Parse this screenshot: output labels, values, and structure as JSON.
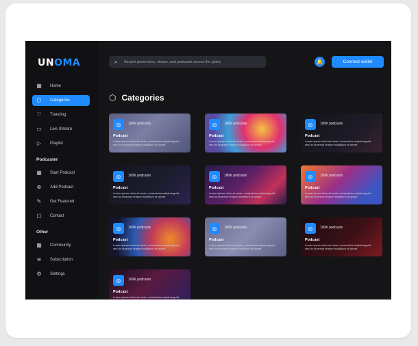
{
  "app": {
    "logo_prefix": "UN",
    "logo_accent": "OMA"
  },
  "sidebar": {
    "main": [
      {
        "label": "Home",
        "icon": "home-icon",
        "glyph": "▦",
        "active": false
      },
      {
        "label": "Categories",
        "icon": "categories-icon",
        "glyph": "⬡",
        "active": true
      },
      {
        "label": "Trending",
        "icon": "trending-icon",
        "glyph": "♡",
        "active": false
      },
      {
        "label": "Live Stream",
        "icon": "live-stream-icon",
        "glyph": "▭",
        "active": false
      },
      {
        "label": "Playlist",
        "icon": "playlist-icon",
        "glyph": "▷",
        "active": false
      }
    ],
    "podcaster_heading": "Podcaster",
    "podcaster": [
      {
        "label": "Start Podcast",
        "icon": "start-podcast-icon",
        "glyph": "▦"
      },
      {
        "label": "Add Podcast",
        "icon": "add-podcast-icon",
        "glyph": "⊕"
      },
      {
        "label": "Get Featured",
        "icon": "get-featured-icon",
        "glyph": "✎"
      },
      {
        "label": "Contact",
        "icon": "contact-icon",
        "glyph": "▢"
      }
    ],
    "other_heading": "Other",
    "other": [
      {
        "label": "Community",
        "icon": "community-icon",
        "glyph": "▦"
      },
      {
        "label": "Subscription",
        "icon": "subscription-icon",
        "glyph": "≋"
      },
      {
        "label": "Settings",
        "icon": "settings-icon",
        "glyph": "⚙"
      }
    ]
  },
  "header": {
    "search_placeholder": "Search presenters, shows, and podcasts across the globe",
    "connect_label": "Connect wallet"
  },
  "main": {
    "title": "Categories",
    "cards": [
      {
        "count": "100K podcasts",
        "title": "Podcast",
        "desc": "Lorem ipsum dolor sit amet, consectetur adipiscing elit, sed do eiusmod tempor incididunt ut labore",
        "bg": "linear-gradient(135deg,#5b5f86 0%,#7c7fa3 45%,#50557a 100%)"
      },
      {
        "count": "180K podcasts",
        "title": "Podcast",
        "desc": "Lorem ipsum dolor sit amet, consectetur adipiscing elit, sed do eiusmod tempor incididunt ut labore",
        "bg": "radial-gradient(circle at 70% 40%,#f5c33b 0%,#e0306f 30%,#3aa0d8 55%,#5a4aa0 80%)"
      },
      {
        "count": "100K podcasts",
        "title": "Podcast",
        "desc": "Lorem ipsum dolor sit amet, consectetur adipiscing elit, sed do eiusmod tempor incididunt ut labore",
        "bg": "linear-gradient(135deg,#15151c 0%,#1c1a26 60%,#3a2330 100%)"
      },
      {
        "count": "100K podcasts",
        "title": "Podcast",
        "desc": "Lorem ipsum dolor sit amet, consectetur adipiscing elit, sed do eiusmod tempor incididunt ut labore",
        "bg": "linear-gradient(135deg,#141420 0%,#1b1b2c 55%,#2a2450 100%)"
      },
      {
        "count": "180K podcasts",
        "title": "Podcast",
        "desc": "Lorem ipsum dolor sit amet, consectetur adipiscing elit, sed do eiusmod tempor incididunt ut labore",
        "bg": "linear-gradient(135deg,#2a1b4a 0%,#5a2065 45%,#c2305b 75%,#2b1e4d 100%)"
      },
      {
        "count": "100K podcasts",
        "title": "Podcast",
        "desc": "Lorem ipsum dolor sit amet, consectetur adipiscing elit, sed do eiusmod tempor incididunt ut labore",
        "bg": "linear-gradient(135deg,#f07a2a 0%,#9a2f8a 45%,#3b56c2 80%)"
      },
      {
        "count": "100K podcasts",
        "title": "Podcast",
        "desc": "Lorem ipsum dolor sit amet, consectetur adipiscing elit, sed do eiusmod tempor incididunt ut labore",
        "bg": "radial-gradient(circle at 75% 55%,#f08a2a 0%,#c03a5a 30%,#2a5ab0 55%,#151530 85%)"
      },
      {
        "count": "180K podcasts",
        "title": "Podcast",
        "desc": "Lorem ipsum dolor sit amet, consectetur adipiscing elit, sed do eiusmod tempor incididunt ut labore",
        "bg": "linear-gradient(135deg,#6a6d90 0%,#8a8db0 50%,#5d6088 100%)"
      },
      {
        "count": "100K podcasts",
        "title": "Podcast",
        "desc": "Lorem ipsum dolor sit amet, consectetur adipiscing elit, sed do eiusmod tempor incididunt ut labore",
        "bg": "linear-gradient(135deg,#1a0c10 0%,#3a1016 55%,#7a1a20 100%)"
      },
      {
        "count": "100K podcasts",
        "title": "Podcast",
        "desc": "Lorem ipsum dolor sit amet, consectetur adipiscing elit, sed do eiusmod tempor incididunt ut labore",
        "bg": "linear-gradient(135deg,#1a1020 0%,#5a1a40 45%,#2a2060 100%)"
      }
    ]
  }
}
